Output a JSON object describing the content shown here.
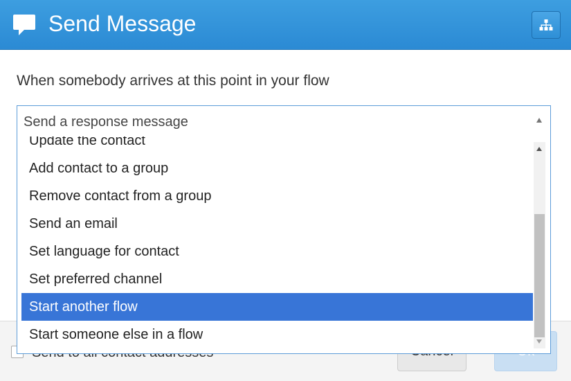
{
  "header": {
    "title": "Send Message",
    "icon": "speech-bubble-icon",
    "flow_button_icon": "sitemap-icon"
  },
  "prompt": "When somebody arrives at this point in your flow",
  "action_select": {
    "value": "Send a response message",
    "options": [
      "Update the contact",
      "Add contact to a group",
      "Remove contact from a group",
      "Send an email",
      "Set language for contact",
      "Set preferred channel",
      "Start another flow",
      "Start someone else in a flow"
    ],
    "highlighted": "Start another flow"
  },
  "footer": {
    "checkbox_label": "Send to all contact addresses",
    "cancel_label": "Cancel",
    "ok_label": "Ok"
  },
  "colors": {
    "header_blue": "#2b8ad4",
    "highlight_blue": "#3875d7",
    "select_border": "#5b9bd8"
  }
}
